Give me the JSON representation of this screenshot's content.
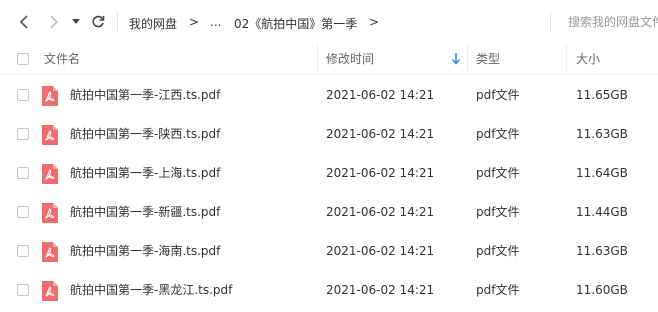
{
  "nav": {
    "back_icon": "chevron-left-icon",
    "forward_icon": "chevron-right-icon",
    "history_icon": "caret-down-icon",
    "refresh_icon": "refresh-icon"
  },
  "breadcrumb": {
    "items": [
      "我的网盘",
      "...",
      "02《航拍中国》第一季"
    ],
    "separator": ">"
  },
  "search": {
    "placeholder": "搜索我的网盘文件"
  },
  "columns": {
    "name": "文件名",
    "modified": "修改时间",
    "type": "类型",
    "size": "大小"
  },
  "sort_icon": "sort-down-arrow-icon",
  "files": [
    {
      "name": "航拍中国第一季-江西.ts.pdf",
      "modified": "2021-06-02 14:21",
      "type": "pdf文件",
      "size": "11.65GB"
    },
    {
      "name": "航拍中国第一季-陕西.ts.pdf",
      "modified": "2021-06-02 14:21",
      "type": "pdf文件",
      "size": "11.63GB"
    },
    {
      "name": "航拍中国第一季-上海.ts.pdf",
      "modified": "2021-06-02 14:21",
      "type": "pdf文件",
      "size": "11.64GB"
    },
    {
      "name": "航拍中国第一季-新疆.ts.pdf",
      "modified": "2021-06-02 14:21",
      "type": "pdf文件",
      "size": "11.44GB"
    },
    {
      "name": "航拍中国第一季-海南.ts.pdf",
      "modified": "2021-06-02 14:21",
      "type": "pdf文件",
      "size": "11.63GB"
    },
    {
      "name": "航拍中国第一季-黑龙江.ts.pdf",
      "modified": "2021-06-02 14:21",
      "type": "pdf文件",
      "size": "11.60GB"
    }
  ],
  "colors": {
    "accent": "#2b8cf0",
    "pdf_icon": "#f05a5a",
    "divider": "#eeeeee"
  }
}
